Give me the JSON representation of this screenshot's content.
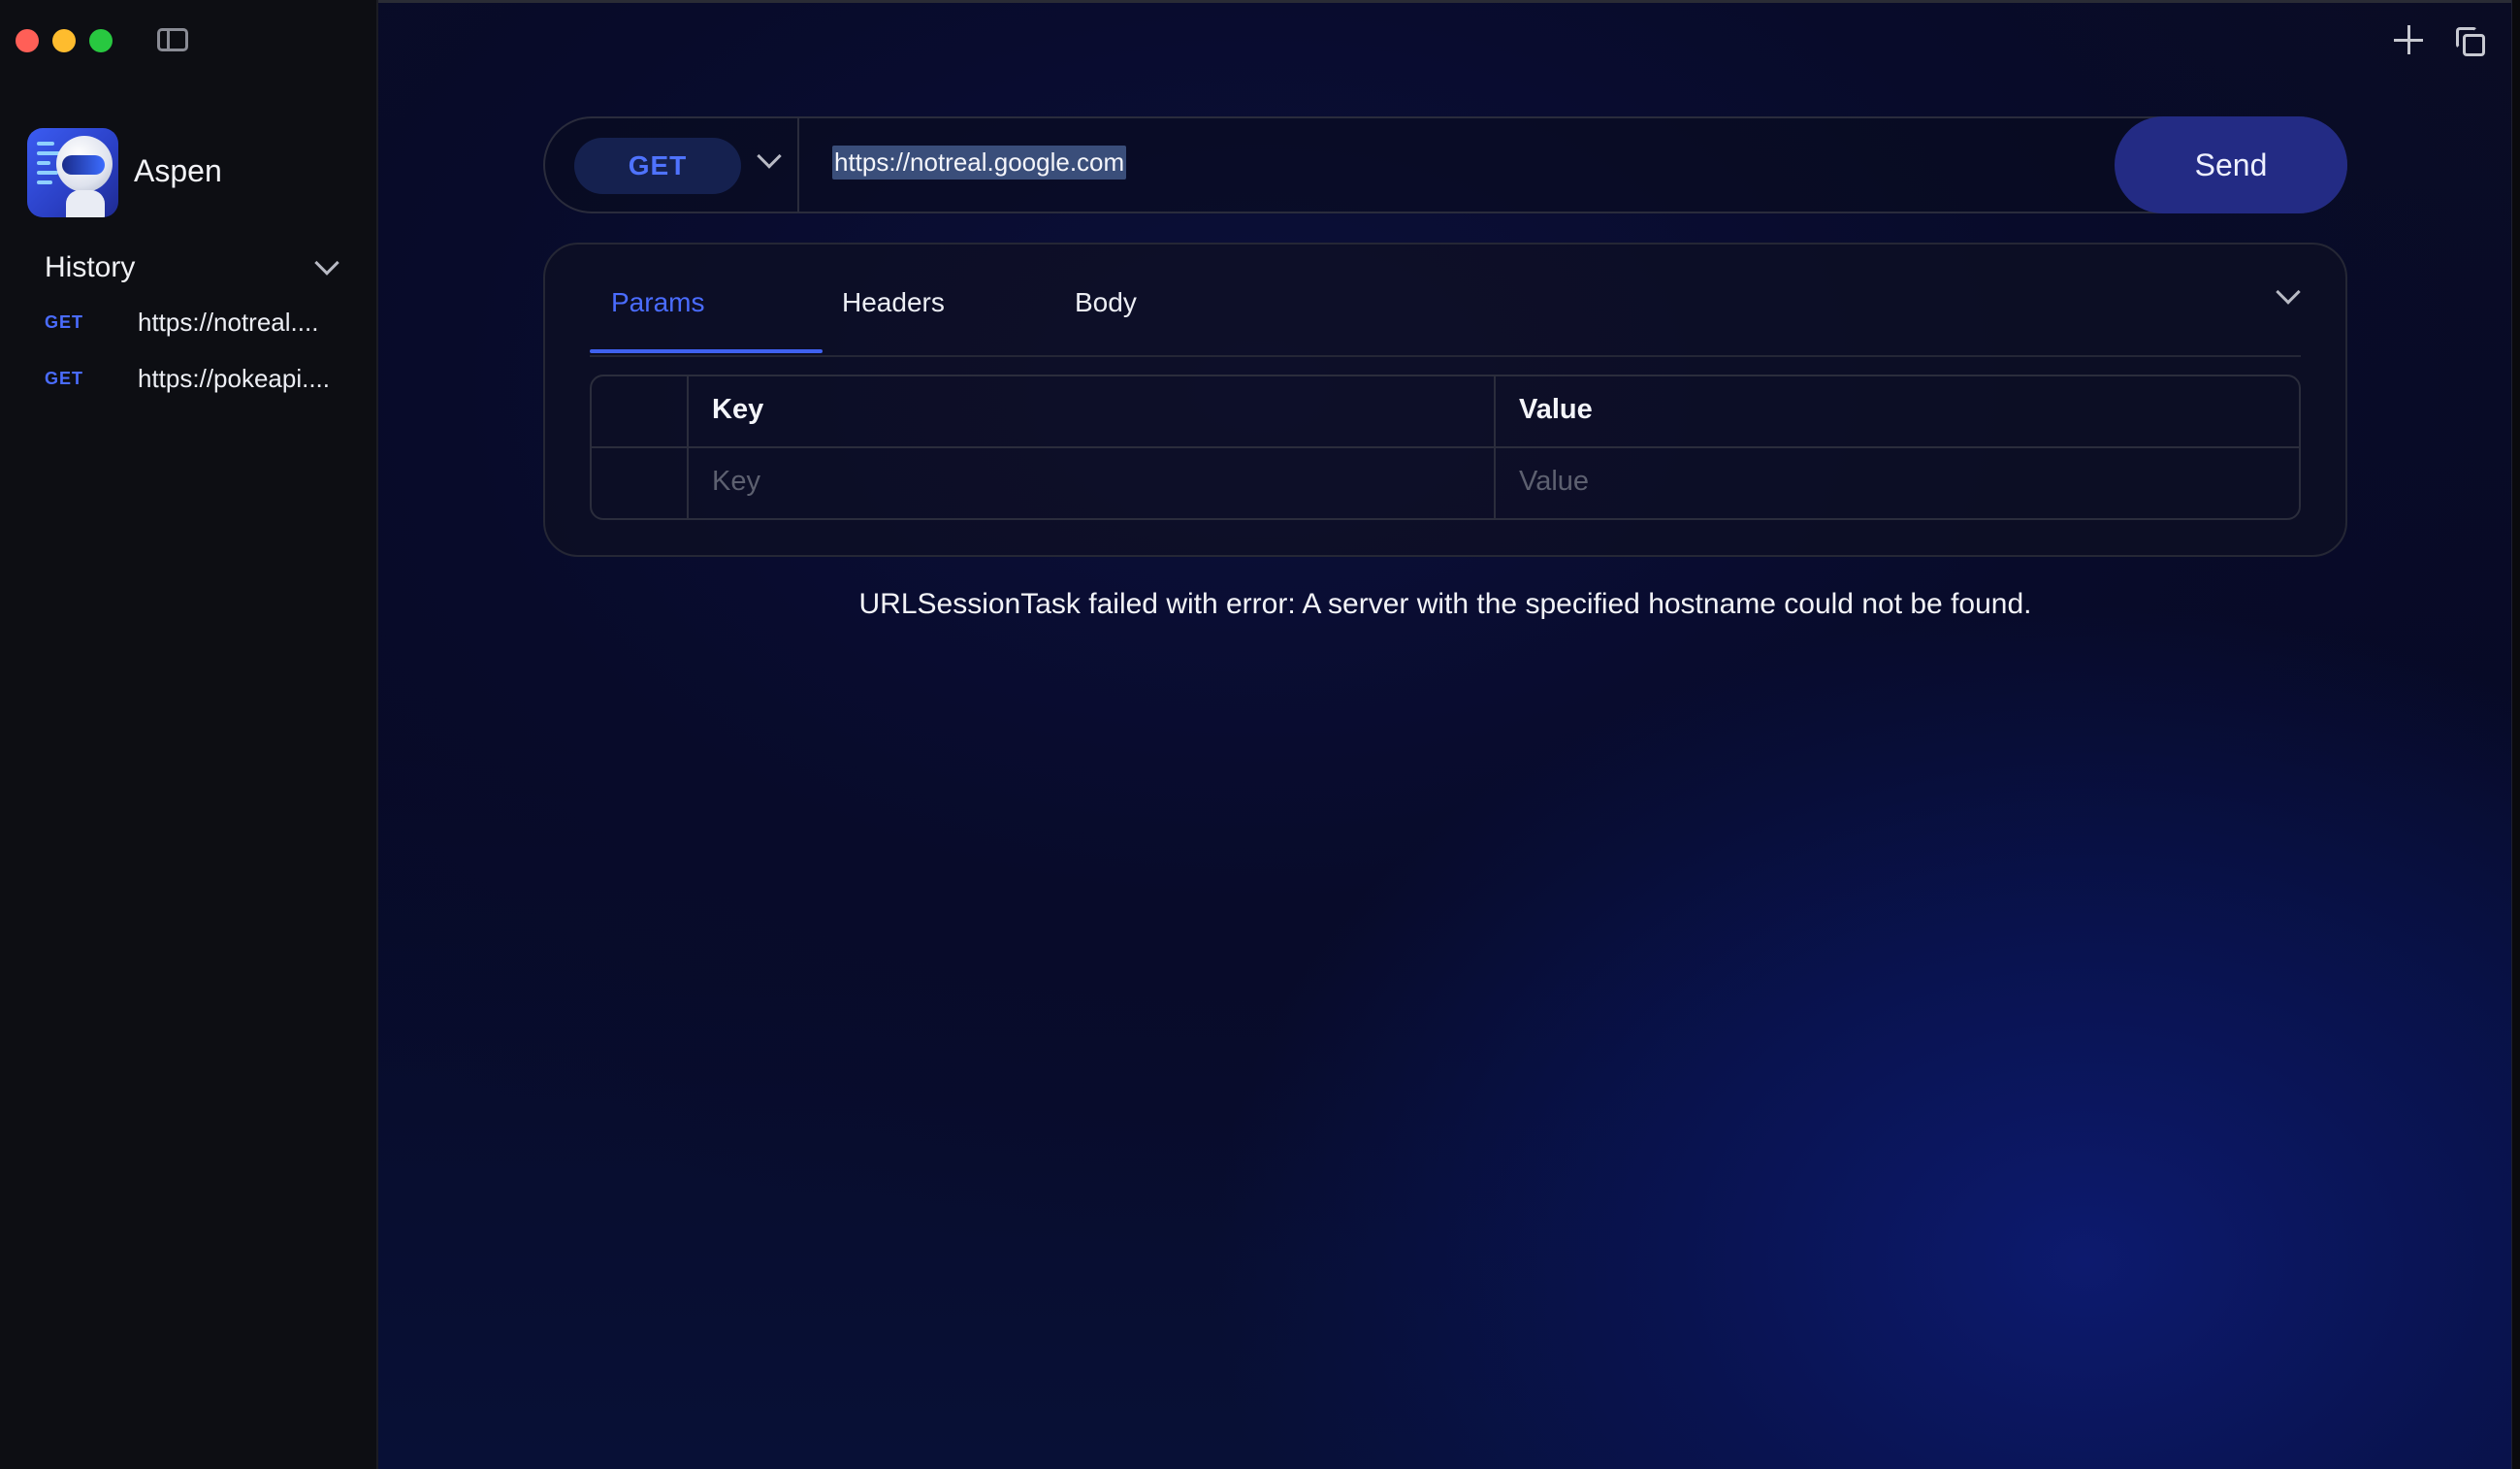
{
  "window": {
    "controls": [
      "close",
      "minimize",
      "zoom"
    ]
  },
  "sidebar": {
    "app_name": "Aspen",
    "history_title": "History",
    "history": [
      {
        "method": "GET",
        "url": "https://notreal...."
      },
      {
        "method": "GET",
        "url": "https://pokeapi...."
      }
    ]
  },
  "request": {
    "method": "GET",
    "url": "https://notreal.google.com",
    "send_label": "Send"
  },
  "tabs": [
    {
      "label": "Params",
      "active": true
    },
    {
      "label": "Headers",
      "active": false
    },
    {
      "label": "Body",
      "active": false
    }
  ],
  "params_table": {
    "key_header": "Key",
    "value_header": "Value",
    "key_placeholder": "Key",
    "value_placeholder": "Value"
  },
  "error_message": "URLSessionTask failed with error: A server with the specified hostname could not be found.",
  "icons": {
    "toolbar": [
      "sidebar-toggle-icon",
      "plus-icon",
      "duplicate-icon"
    ],
    "chevrons": [
      "chevron-down-icon"
    ]
  },
  "colors": {
    "accent": "#4a6cff",
    "send_button": "#232b84",
    "sidebar_bg": "#0d0e13"
  }
}
